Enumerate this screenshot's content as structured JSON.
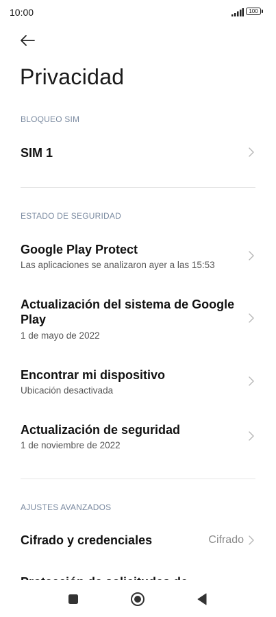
{
  "status_bar": {
    "time": "10:00",
    "battery": "100"
  },
  "header": {
    "back_icon": "arrow-left-icon",
    "title": "Privacidad"
  },
  "sections": [
    {
      "header": "BLOQUEO SIM",
      "items": [
        {
          "title": "SIM 1"
        }
      ]
    },
    {
      "header": "ESTADO DE SEGURIDAD",
      "items": [
        {
          "title": "Google Play Protect",
          "subtitle": "Las aplicaciones se analizaron ayer a las 15:53"
        },
        {
          "title": "Actualización del sistema de Google Play",
          "subtitle": "1 de mayo de 2022"
        },
        {
          "title": "Encontrar mi dispositivo",
          "subtitle": "Ubicación desactivada"
        },
        {
          "title": "Actualización de seguridad",
          "subtitle": "1 de noviembre de 2022"
        }
      ]
    },
    {
      "header": "AJUSTES AVANZADOS",
      "items": [
        {
          "title": "Cifrado y credenciales",
          "value": "Cifrado"
        },
        {
          "title": "Protección de solicitudes de"
        }
      ]
    }
  ],
  "nav_bar": {
    "recents_icon": "square-icon",
    "home_icon": "circle-icon",
    "back_icon": "triangle-back-icon"
  },
  "colors": {
    "section_header": "#7a8aa0",
    "divider": "#e6e6e6",
    "chevron": "#b5b5b5",
    "subtitle": "#555555"
  }
}
